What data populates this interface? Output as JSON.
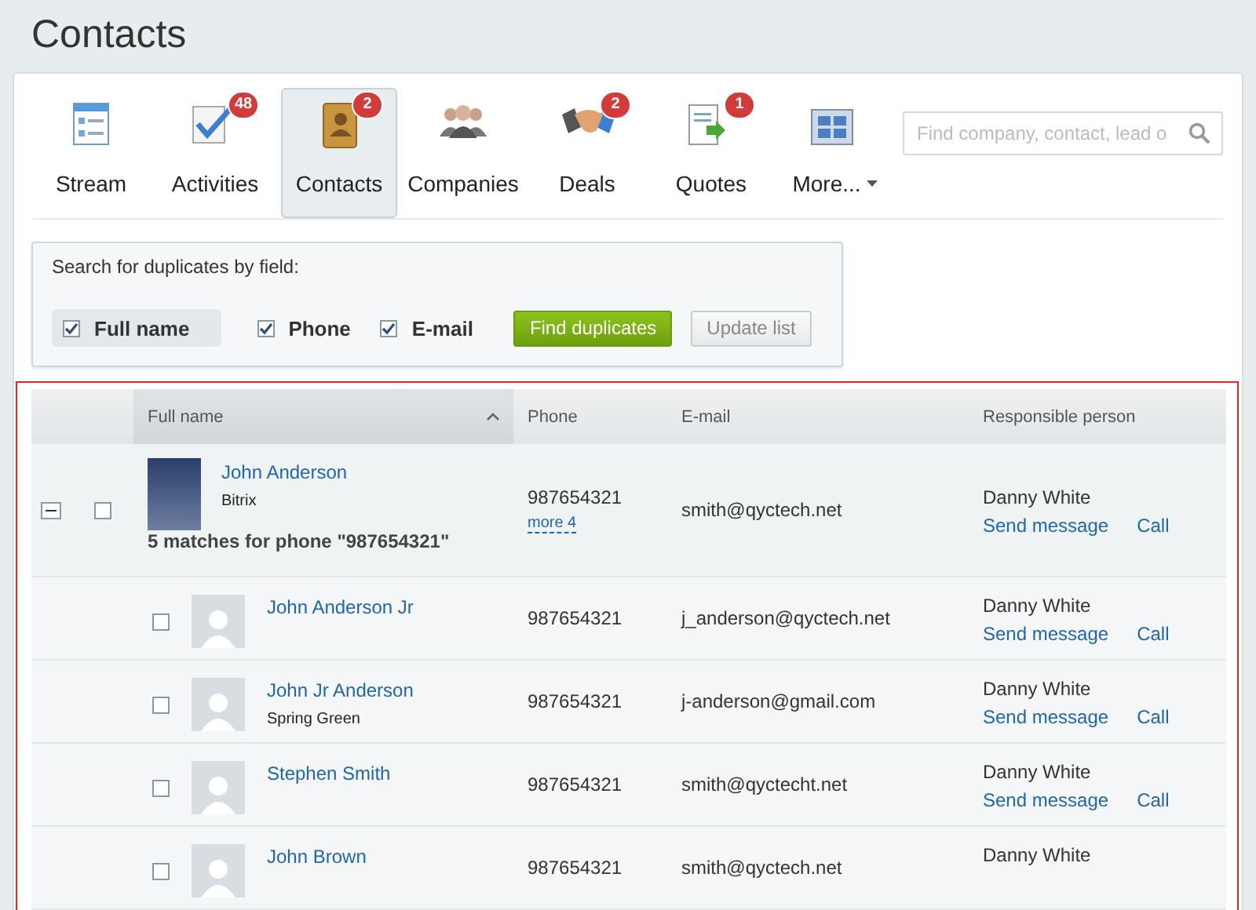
{
  "page_title": "Contacts",
  "toolbar": {
    "items": [
      {
        "kind": "stream",
        "label": "Stream",
        "selected": false
      },
      {
        "kind": "activities",
        "label": "Activities",
        "badge": "48",
        "selected": false
      },
      {
        "kind": "contacts",
        "label": "Contacts",
        "badge": "2",
        "selected": true
      },
      {
        "kind": "companies",
        "label": "Companies",
        "selected": false
      },
      {
        "kind": "deals",
        "label": "Deals",
        "badge": "2",
        "selected": false
      },
      {
        "kind": "quotes",
        "label": "Quotes",
        "badge": "1",
        "selected": false
      },
      {
        "kind": "more",
        "label": "More...",
        "selected": false
      }
    ],
    "search": {
      "placeholder": "Find company, contact, lead o"
    }
  },
  "duplicate_filter": {
    "title": "Search for duplicates by field:",
    "fields": [
      {
        "label": "Full name",
        "checked": true,
        "selected": true
      },
      {
        "label": "Phone",
        "checked": true,
        "selected": false
      },
      {
        "label": "E-mail",
        "checked": true,
        "selected": false
      }
    ],
    "buttons": [
      {
        "kind": "primary",
        "label": "Find duplicates"
      },
      {
        "kind": "secondary",
        "label": "Update list"
      }
    ]
  },
  "table": {
    "columns": [
      {
        "label": "Full name",
        "sorted": true
      },
      {
        "label": "Phone",
        "sorted": false
      },
      {
        "label": "E-mail",
        "sorted": false
      },
      {
        "label": "Responsible person",
        "sorted": false
      }
    ],
    "group": {
      "expanded": true,
      "checked": false,
      "name": "John Anderson",
      "company": "Bitrix",
      "phone": "987654321",
      "more": "more 4",
      "email": "smith@qyctech.net",
      "responsible": "Danny White",
      "actions": [
        "Send message",
        "Call"
      ],
      "summary": "5 matches for phone \"987654321\""
    },
    "rows": [
      {
        "checked": false,
        "name": "John Anderson Jr",
        "phone": "987654321",
        "email": "j_anderson@qyctech.net",
        "responsible": "Danny White",
        "actions": [
          "Send message",
          "Call"
        ]
      },
      {
        "checked": false,
        "name": "John Jr Anderson",
        "company": "Spring Green",
        "phone": "987654321",
        "email": "j-anderson@gmail.com",
        "responsible": "Danny White",
        "actions": [
          "Send message",
          "Call"
        ]
      },
      {
        "checked": false,
        "name": "Stephen Smith",
        "phone": "987654321",
        "email": "smith@qyctecht.net",
        "responsible": "Danny White",
        "actions": [
          "Send message",
          "Call"
        ]
      },
      {
        "checked": false,
        "name": "John Brown",
        "phone": "987654321",
        "email": "smith@qyctech.net",
        "responsible": "Danny White"
      }
    ]
  }
}
